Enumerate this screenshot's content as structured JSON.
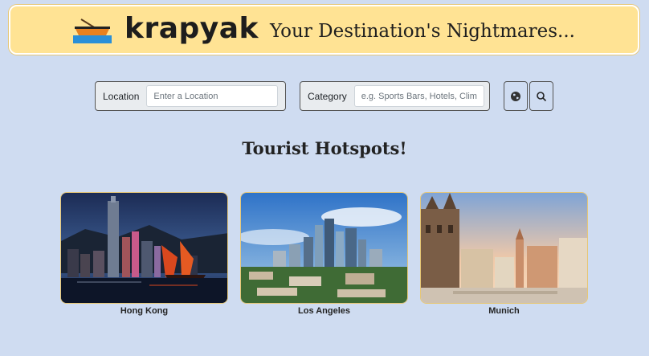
{
  "header": {
    "brand": "krapyak",
    "tagline": "Your Destination's Nightmares..."
  },
  "search": {
    "location_label": "Location",
    "location_placeholder": "Enter a Location",
    "location_value": "",
    "category_label": "Category",
    "category_placeholder": "e.g. Sports Bars, Hotels, Climbing Gyms",
    "category_value": "",
    "globe_icon": "globe-icon",
    "search_icon": "search-icon"
  },
  "hotspots": {
    "title": "Tourist Hotspots!",
    "cities": [
      {
        "name": "Hong Kong"
      },
      {
        "name": "Los Angeles"
      },
      {
        "name": "Munich"
      }
    ]
  },
  "colors": {
    "background": "#cfdcf1",
    "banner": "#ffe394",
    "card_border": "#e6c777"
  }
}
